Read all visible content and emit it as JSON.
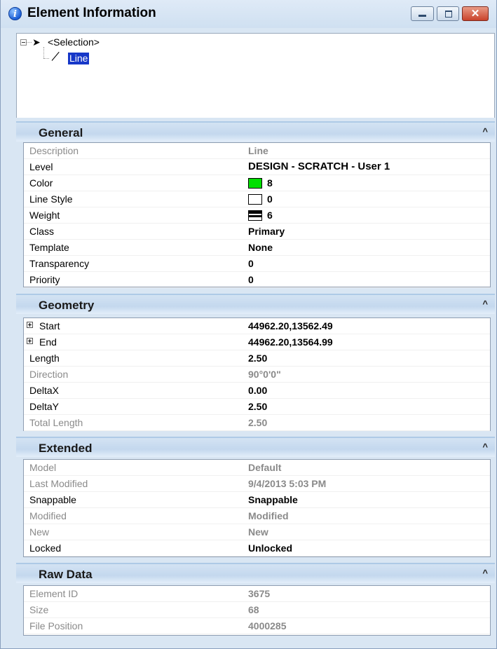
{
  "window": {
    "title": "Element Information",
    "info_icon": "info-icon",
    "buttons": {
      "minimize": "minimize-icon",
      "maximize": "maximize-icon",
      "close": "close-icon",
      "close_glyph": "✕"
    }
  },
  "tree": {
    "root_label": "<Selection>",
    "root_icon": "arrow-cursor-icon",
    "child_label": "Line",
    "child_icon": "line-icon"
  },
  "sections": {
    "general": {
      "title": "General",
      "rows": [
        {
          "label": "Description",
          "value": "Line"
        },
        {
          "label": "Level",
          "value": "DESIGN - SCRATCH - User 1"
        },
        {
          "label": "Color",
          "value": "8"
        },
        {
          "label": "Line Style",
          "value": "0"
        },
        {
          "label": "Weight",
          "value": "6"
        },
        {
          "label": "Class",
          "value": "Primary"
        },
        {
          "label": "Template",
          "value": "None"
        },
        {
          "label": "Transparency",
          "value": "0"
        },
        {
          "label": "Priority",
          "value": "0"
        }
      ]
    },
    "geometry": {
      "title": "Geometry",
      "rows": [
        {
          "label": "Start",
          "value": "44962.20,13562.49"
        },
        {
          "label": "End",
          "value": "44962.20,13564.99"
        },
        {
          "label": "Length",
          "value": "2.50"
        },
        {
          "label": "Direction",
          "value": "90°0'0\""
        },
        {
          "label": "DeltaX",
          "value": "0.00"
        },
        {
          "label": "DeltaY",
          "value": "2.50"
        },
        {
          "label": "Total Length",
          "value": "2.50"
        }
      ]
    },
    "extended": {
      "title": "Extended",
      "rows": [
        {
          "label": "Model",
          "value": "Default"
        },
        {
          "label": "Last Modified",
          "value": "9/4/2013 5:03 PM"
        },
        {
          "label": "Snappable",
          "value": "Snappable"
        },
        {
          "label": "Modified",
          "value": "Modified"
        },
        {
          "label": "New",
          "value": "New"
        },
        {
          "label": "Locked",
          "value": "Unlocked"
        }
      ]
    },
    "raw": {
      "title": "Raw Data",
      "rows": [
        {
          "label": "Element ID",
          "value": "3675"
        },
        {
          "label": "Size",
          "value": "68"
        },
        {
          "label": "File Position",
          "value": "4000285"
        }
      ]
    }
  },
  "colors": {
    "color_swatch": "#00e000",
    "selection_highlight": "#1637c8",
    "section_header": "#c4d8ee",
    "window_frame": "#d9e6f3",
    "close_button": "#c9432b"
  }
}
